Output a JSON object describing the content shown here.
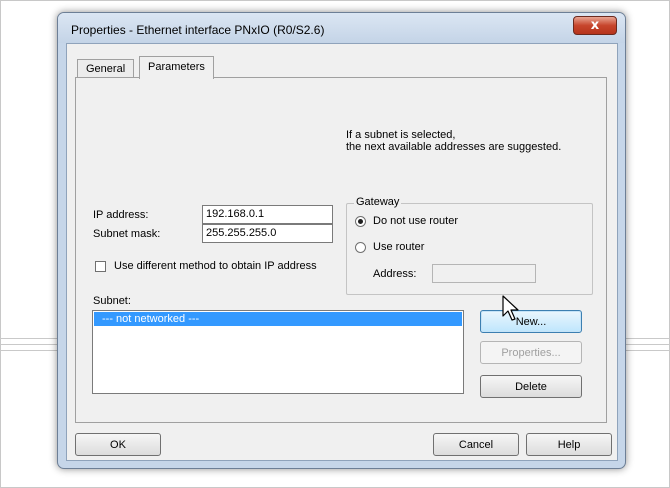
{
  "window": {
    "title": "Properties - Ethernet interface  PNxIO (R0/S2.6)",
    "close_symbol": "x"
  },
  "tabs": [
    {
      "label": "General",
      "active": false
    },
    {
      "label": "Parameters",
      "active": true
    }
  ],
  "hint": {
    "line1": "If a subnet is selected,",
    "line2": "the next available addresses are suggested."
  },
  "ip": {
    "label": "IP address:",
    "value": "192.168.0.1"
  },
  "subnet_mask": {
    "label": "Subnet mask:",
    "value": "255.255.255.0"
  },
  "different_method": {
    "label": "Use different method to obtain IP address",
    "checked": false
  },
  "gateway": {
    "title": "Gateway",
    "option_no_router": "Do not use router",
    "option_use_router": "Use router",
    "selected": "no_router",
    "address_label": "Address:",
    "address_value": ""
  },
  "subnet": {
    "label": "Subnet:",
    "items": [
      "--- not networked ---"
    ],
    "selected_index": 0
  },
  "subnet_buttons": {
    "new": "New...",
    "properties": "Properties...",
    "delete": "Delete"
  },
  "footer": {
    "ok": "OK",
    "cancel": "Cancel",
    "help": "Help"
  }
}
